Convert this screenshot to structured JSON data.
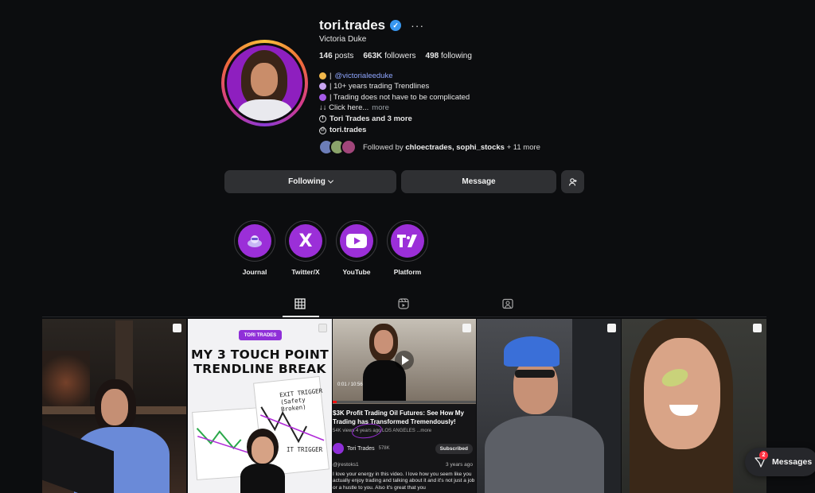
{
  "profile": {
    "username": "tori.trades",
    "full_name": "Victoria Duke",
    "stats": {
      "posts": "146",
      "posts_label": "posts",
      "followers": "663K",
      "followers_label": "followers",
      "following": "498",
      "following_label": "following"
    },
    "bio": {
      "line1": "@victorialeeduke",
      "line2": "| 10+ years trading Trendlines",
      "line3": "| Trading does not have to be complicated",
      "line4": "↓↓ Click here...",
      "more": "more",
      "fb_link": "Tori Trades and 3 more",
      "threads_link": "tori.trades",
      "pipe": "|"
    },
    "followed_by": {
      "prefix": "Followed by",
      "names": "chloectrades, sophi_stocks",
      "suffix": "+ 11 more"
    }
  },
  "actions": {
    "following_label": "Following",
    "message_label": "Message"
  },
  "highlights": [
    {
      "label": "Journal"
    },
    {
      "label": "Twitter/X"
    },
    {
      "label": "YouTube"
    },
    {
      "label": "Platform"
    }
  ],
  "posts": {
    "p2": {
      "badge": "TORI TRADES",
      "title": "MY 3 TOUCH POINT TRENDLINE BREAK",
      "exit": "EXIT TRIGGER",
      "exit_sub": "(Safety Broken)",
      "trigger": "IT TRIGGER"
    },
    "p3": {
      "time": "0:01 / 10:56",
      "title": "$3K Profit Trading Oil Futures: See How My Trading has Transformed Tremendously!",
      "meta": "54K views  4 years ago  LOS ANGELES  ...more",
      "channel": "Tori Trades",
      "subs": "578K",
      "subscribed": "Subscribed",
      "commenter": "@jrestoks1",
      "comment_time": "3 years ago",
      "comment": "I love your energy in this video. I love how you seem like you actually enjoy trading and talking about it and it's not just a job or a hustle to you. Also it's great that you"
    }
  },
  "messages_pill": {
    "label": "Messages",
    "badge": "2"
  },
  "colors": {
    "accent_purple": "#9b2fd8",
    "verified_blue": "#3897f0",
    "link": "#8fa6ff"
  }
}
